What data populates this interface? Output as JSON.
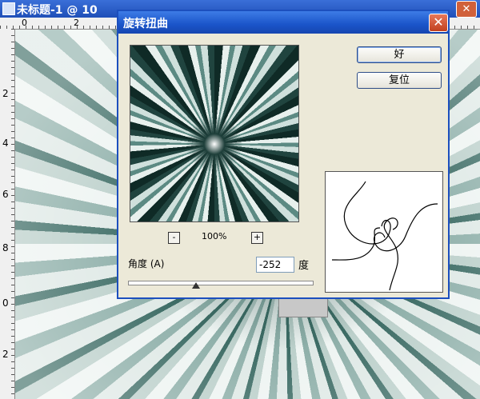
{
  "document": {
    "title": "未标题-1 @ 10",
    "ruler_top": [
      "0",
      "2"
    ],
    "ruler_left": [
      "2",
      "4",
      "6",
      "8",
      "0",
      "2"
    ]
  },
  "dialog": {
    "title": "旋转扭曲",
    "close_glyph": "✕",
    "ok_label": "好",
    "reset_label": "复位",
    "zoom_minus": "-",
    "zoom_plus": "+",
    "zoom_level": "100%",
    "angle_label": "角度 (A)",
    "angle_value": "-252",
    "angle_unit": "度",
    "angle_fraction": 0.37
  }
}
